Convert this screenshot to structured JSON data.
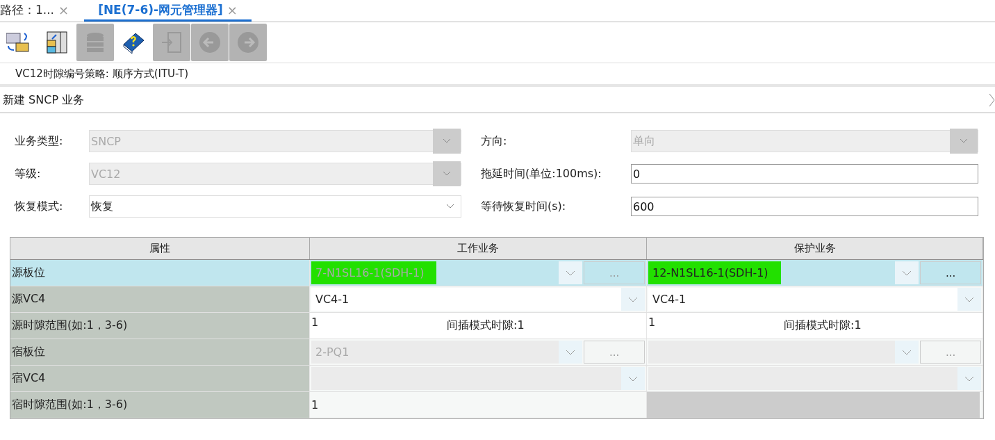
{
  "tabs": [
    {
      "label": "路径：1...",
      "selected": false,
      "close": "×"
    },
    {
      "label": "[NE(7-6)-网元管理器]",
      "selected": true,
      "close": "×"
    }
  ],
  "toolbar": [
    {
      "kind": "sync",
      "disabled": false
    },
    {
      "kind": "layout",
      "disabled": false
    },
    {
      "kind": "database",
      "disabled": true
    },
    {
      "kind": "help",
      "disabled": false
    },
    {
      "kind": "login",
      "disabled": true
    },
    {
      "kind": "back",
      "disabled": true
    },
    {
      "kind": "forward",
      "disabled": true
    }
  ],
  "info": "VC12时隙编号策略:  顺序方式(ITU-T)",
  "section_title": "新建 SNCP 业务",
  "form": [
    {
      "label": "业务类型:",
      "kind": "select",
      "value": "SNCP",
      "disabled": true
    },
    {
      "label": "方向:",
      "kind": "select",
      "value": "单向",
      "disabled": true
    },
    {
      "label": "等级:",
      "kind": "select",
      "value": "VC12",
      "disabled": true
    },
    {
      "label": "拖延时间(单位:100ms):",
      "kind": "input",
      "value": "0"
    },
    {
      "label": "恢复模式:",
      "kind": "select",
      "value": "恢复",
      "disabled": false
    },
    {
      "label": "等待恢复时间(s):",
      "kind": "input",
      "value": "600"
    }
  ],
  "table": {
    "columns": [
      "属性",
      "工作业务",
      "保护业务"
    ],
    "rows": [
      {
        "selected": true,
        "cells": [
          {
            "kind": "label",
            "value": "源板位"
          },
          {
            "kind": "select_browse",
            "value": "7-N1SL16-1(SDH-1)",
            "highlighted": true,
            "disabled": true,
            "browse": "..."
          },
          {
            "kind": "select_browse",
            "value": "12-N1SL16-1(SDH-1)",
            "highlighted": true,
            "disabled": false,
            "browse": "..."
          }
        ]
      },
      {
        "selected": false,
        "cells": [
          {
            "kind": "label",
            "value": "源VC4"
          },
          {
            "kind": "select",
            "value": "VC4-1",
            "disabled": false
          },
          {
            "kind": "select",
            "value": "VC4-1",
            "disabled": false
          }
        ]
      },
      {
        "selected": false,
        "cells": [
          {
            "kind": "label",
            "value": "源时隙范围(如:1，3-6)"
          },
          {
            "kind": "slot",
            "value": "1",
            "note": "间插模式时隙:1"
          },
          {
            "kind": "slot",
            "value": "1",
            "note": "间插模式时隙:1"
          }
        ]
      },
      {
        "selected": false,
        "cells": [
          {
            "kind": "label",
            "value": "宿板位"
          },
          {
            "kind": "select_browse",
            "value": "2-PQ1",
            "highlighted": false,
            "disabled": true,
            "browse": "..."
          },
          {
            "kind": "select_browse",
            "disabled": true,
            "browse": "..."
          }
        ]
      },
      {
        "selected": false,
        "cells": [
          {
            "kind": "label",
            "value": "宿VC4"
          },
          {
            "kind": "select",
            "disabled": true
          },
          {
            "kind": "select",
            "disabled": true
          }
        ]
      },
      {
        "selected": false,
        "cells": [
          {
            "kind": "label",
            "value": "宿时隙范围(如:1，3-6)"
          },
          {
            "kind": "text",
            "value": "1"
          },
          {
            "kind": "blank"
          }
        ]
      }
    ]
  }
}
